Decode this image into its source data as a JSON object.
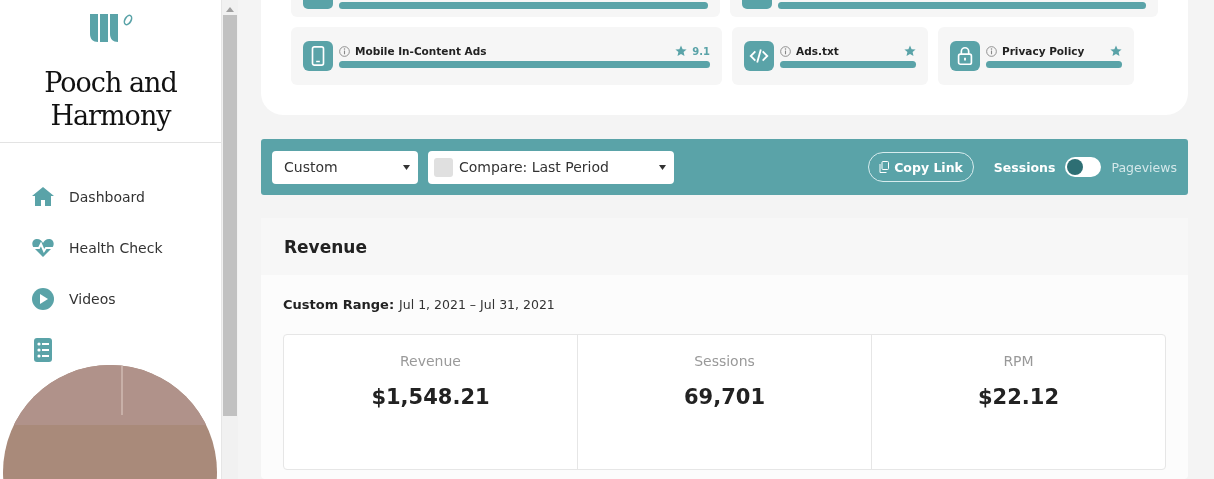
{
  "sidebar": {
    "site_name": "Pooch and Harmony",
    "items": [
      {
        "label": "Dashboard",
        "kind": "home"
      },
      {
        "label": "Health Check",
        "kind": "heart"
      },
      {
        "label": "Videos",
        "kind": "play"
      },
      {
        "kind": "list"
      }
    ]
  },
  "health_check": {
    "partial_row": [
      {
        "level": 1
      },
      {
        "level": 1
      }
    ],
    "items": [
      {
        "title": "Mobile In-Content Ads",
        "kind": "phone",
        "score": "9.1",
        "level": 1
      },
      {
        "title": "Ads.txt",
        "kind": "code",
        "level": 1
      },
      {
        "title": "Privacy Policy",
        "kind": "lock",
        "level": 1
      }
    ]
  },
  "filter_bar": {
    "range_select": "Custom",
    "compare": {
      "checked": false,
      "label": "Compare: Last Period"
    },
    "copy_link": "Copy Link",
    "toggle": {
      "left_label": "Sessions",
      "right_label": "Pageviews",
      "on": false
    }
  },
  "revenue": {
    "title": "Revenue",
    "range_label": "Custom Range:",
    "range_value": "Jul 1, 2021 – Jul 31, 2021",
    "stats": [
      {
        "label": "Revenue",
        "value": "$1,548.21"
      },
      {
        "label": "Sessions",
        "value": "69,701"
      },
      {
        "label": "RPM",
        "value": "$22.12"
      }
    ]
  }
}
